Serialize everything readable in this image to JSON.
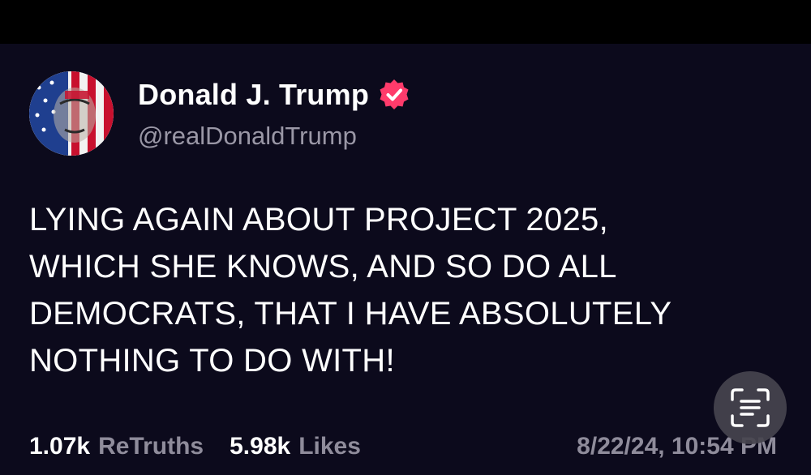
{
  "author": {
    "display_name": "Donald J. Trump",
    "handle": "@realDonaldTrump",
    "verified_badge_icon": "verified-check-icon",
    "avatar_icon": "flag-portrait-avatar"
  },
  "post": {
    "lines": [
      "LYING AGAIN ABOUT PROJECT 2025,",
      "WHICH SHE KNOWS, AND SO DO ALL",
      "DEMOCRATS, THAT I HAVE ABSOLUTELY",
      "NOTHING TO DO WITH!"
    ]
  },
  "stats": {
    "retruths_count": "1.07k",
    "retruths_label": "ReTruths",
    "likes_count": "5.98k",
    "likes_label": "Likes"
  },
  "timestamp": "8/22/24, 10:54 PM",
  "overlay": {
    "live_text_icon": "text-scan-icon"
  },
  "colors": {
    "background": "#0c0a1c",
    "text": "#ffffff",
    "muted": "#8f8c9b",
    "badge": "#ff3b6b"
  }
}
